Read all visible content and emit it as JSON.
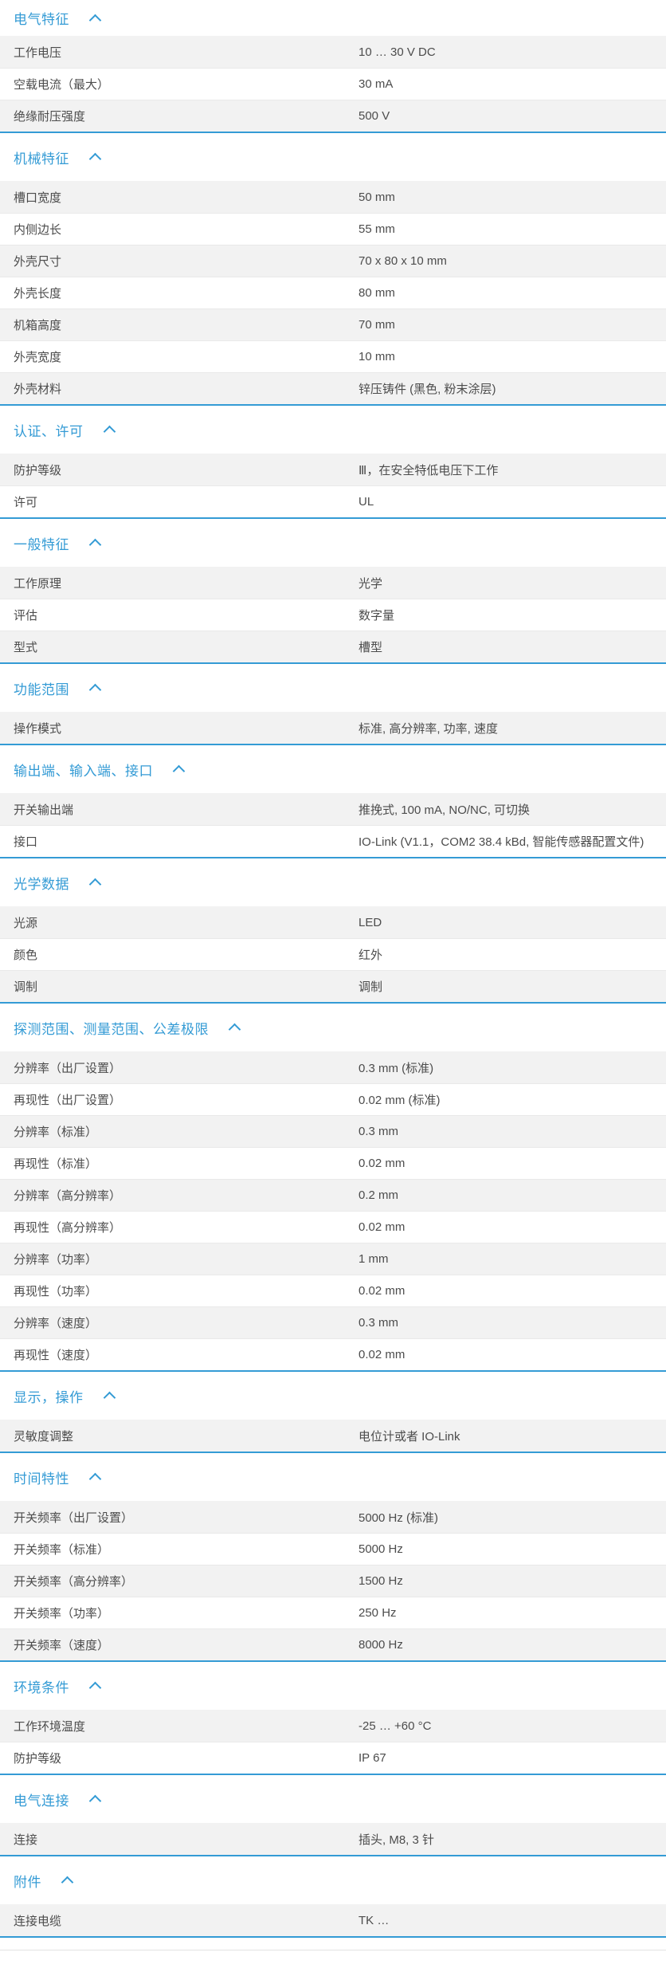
{
  "colors": {
    "accent": "#349bd5",
    "row_alt_bg": "#f2f2f2",
    "row_text": "#4c4c4c",
    "divider": "#e3e3e3"
  },
  "collapse_icon": "chevron-up",
  "sections": [
    {
      "title": "电气特征",
      "rows": [
        {
          "label": "工作电压",
          "value": "10 … 30 V DC"
        },
        {
          "label": "空载电流（最大）",
          "value": "30 mA"
        },
        {
          "label": "绝缘耐压强度",
          "value": "500 V"
        }
      ]
    },
    {
      "title": "机械特征",
      "rows": [
        {
          "label": "槽口宽度",
          "value": "50 mm"
        },
        {
          "label": "内侧边长",
          "value": "55 mm"
        },
        {
          "label": "外壳尺寸",
          "value": "70 x 80 x 10 mm"
        },
        {
          "label": "外壳长度",
          "value": "80 mm"
        },
        {
          "label": "机箱高度",
          "value": "70 mm"
        },
        {
          "label": "外壳宽度",
          "value": "10 mm"
        },
        {
          "label": "外壳材料",
          "value": "锌压铸件 (黑色, 粉末涂层)"
        }
      ]
    },
    {
      "title": "认证、许可",
      "rows": [
        {
          "label": "防护等级",
          "value": "Ⅲ，在安全特低电压下工作"
        },
        {
          "label": "许可",
          "value": "UL"
        }
      ]
    },
    {
      "title": "一般特征",
      "rows": [
        {
          "label": "工作原理",
          "value": "光学"
        },
        {
          "label": "评估",
          "value": "数字量"
        },
        {
          "label": "型式",
          "value": "槽型"
        }
      ]
    },
    {
      "title": "功能范围",
      "rows": [
        {
          "label": "操作模式",
          "value": "标准, 高分辨率, 功率, 速度"
        }
      ]
    },
    {
      "title": "输出端、输入端、接口",
      "rows": [
        {
          "label": "开关输出端",
          "value": "推挽式, 100 mA, NO/NC, 可切换"
        },
        {
          "label": "接口",
          "value": "IO-Link (V1.1，COM2 38.4 kBd, 智能传感器配置文件)"
        }
      ]
    },
    {
      "title": "光学数据",
      "rows": [
        {
          "label": "光源",
          "value": "LED"
        },
        {
          "label": "颜色",
          "value": "红外"
        },
        {
          "label": "调制",
          "value": "调制"
        }
      ]
    },
    {
      "title": "探测范围、测量范围、公差极限",
      "rows": [
        {
          "label": "分辨率（出厂设置）",
          "value": "0.3 mm (标准)"
        },
        {
          "label": "再现性（出厂设置）",
          "value": "0.02 mm (标准)"
        },
        {
          "label": "分辨率（标准）",
          "value": "0.3 mm"
        },
        {
          "label": "再现性（标准）",
          "value": "0.02 mm"
        },
        {
          "label": "分辨率（高分辨率）",
          "value": "0.2 mm"
        },
        {
          "label": "再现性（高分辨率）",
          "value": "0.02 mm"
        },
        {
          "label": "分辨率（功率）",
          "value": "1 mm"
        },
        {
          "label": "再现性（功率）",
          "value": "0.02 mm"
        },
        {
          "label": "分辨率（速度）",
          "value": "0.3 mm"
        },
        {
          "label": "再现性（速度）",
          "value": "0.02 mm"
        }
      ]
    },
    {
      "title": "显示，操作",
      "rows": [
        {
          "label": "灵敏度调整",
          "value": "电位计或者 IO-Link"
        }
      ]
    },
    {
      "title": "时间特性",
      "rows": [
        {
          "label": "开关频率（出厂设置）",
          "value": "5000 Hz (标准)"
        },
        {
          "label": "开关频率（标准）",
          "value": "5000 Hz"
        },
        {
          "label": "开关频率（高分辨率）",
          "value": "1500 Hz"
        },
        {
          "label": "开关频率（功率）",
          "value": "250 Hz"
        },
        {
          "label": "开关频率（速度）",
          "value": "8000 Hz"
        }
      ]
    },
    {
      "title": "环境条件",
      "rows": [
        {
          "label": "工作环境温度",
          "value": "-25 … +60 °C"
        },
        {
          "label": "防护等级",
          "value": "IP 67"
        }
      ]
    },
    {
      "title": "电气连接",
      "rows": [
        {
          "label": "连接",
          "value": "插头, M8, 3 针"
        }
      ]
    },
    {
      "title": "附件",
      "rows": [
        {
          "label": "连接电缆",
          "value": "TK …"
        }
      ]
    }
  ]
}
